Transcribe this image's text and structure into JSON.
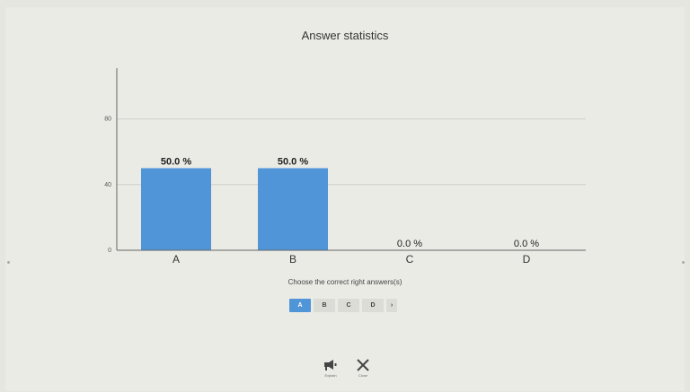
{
  "title": "Answer statistics",
  "chart_data": {
    "type": "bar",
    "title": "Answer statistics",
    "categories": [
      "A",
      "B",
      "C",
      "D"
    ],
    "values": [
      50.0,
      50.0,
      0.0,
      0.0
    ],
    "value_labels": [
      "50.0  %",
      "50.0  %",
      "0.0 %",
      "0.0 %"
    ],
    "y_ticks": [
      "0",
      "40",
      "80"
    ],
    "ylim": [
      0,
      100
    ],
    "grid": true,
    "bar_color": "#4f95d8"
  },
  "question": {
    "prompt": "Choose the correct right answers(s)",
    "options": [
      "A",
      "B",
      "C",
      "D"
    ],
    "selected": "A",
    "more_icon": "chevron-right-icon"
  },
  "actions": {
    "explain_label": "Explain",
    "explain_icon": "megaphone-icon",
    "close_label": "Close",
    "close_icon": "close-icon"
  }
}
